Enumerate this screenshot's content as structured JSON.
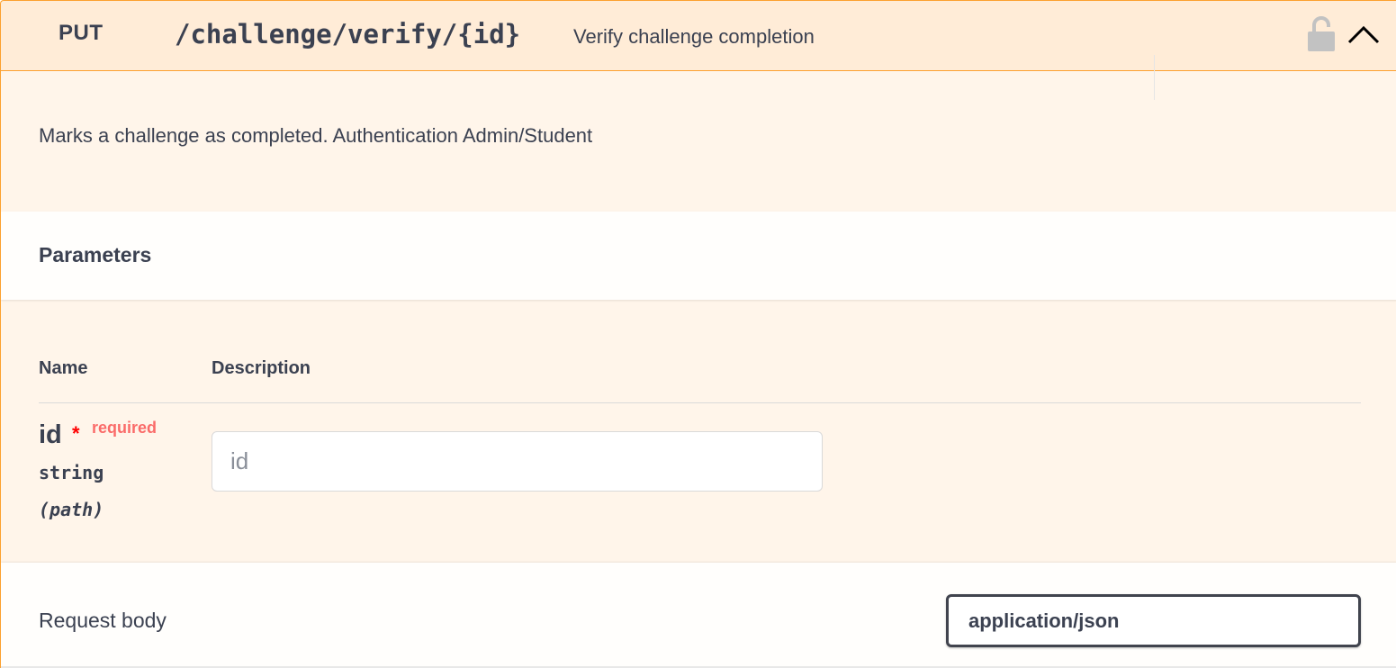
{
  "operation": {
    "method": "PUT",
    "path": "/challenge/verify/{id}",
    "summary": "Verify challenge completion",
    "description": "Marks a challenge as completed. Authentication Admin/Student"
  },
  "parameters": {
    "title": "Parameters",
    "columns": {
      "name": "Name",
      "description": "Description"
    },
    "items": [
      {
        "name": "id",
        "required_marker": "*",
        "required_label": "required",
        "type": "string",
        "location": "(path)",
        "placeholder": "id",
        "value": ""
      }
    ]
  },
  "request_body": {
    "label": "Request body",
    "content_type": "application/json"
  },
  "icons": {
    "lock": "lock-icon",
    "collapse": "chevron-up-icon"
  },
  "colors": {
    "put_accent": "#fca130",
    "required": "#f93e3e",
    "text": "#3b4151"
  }
}
